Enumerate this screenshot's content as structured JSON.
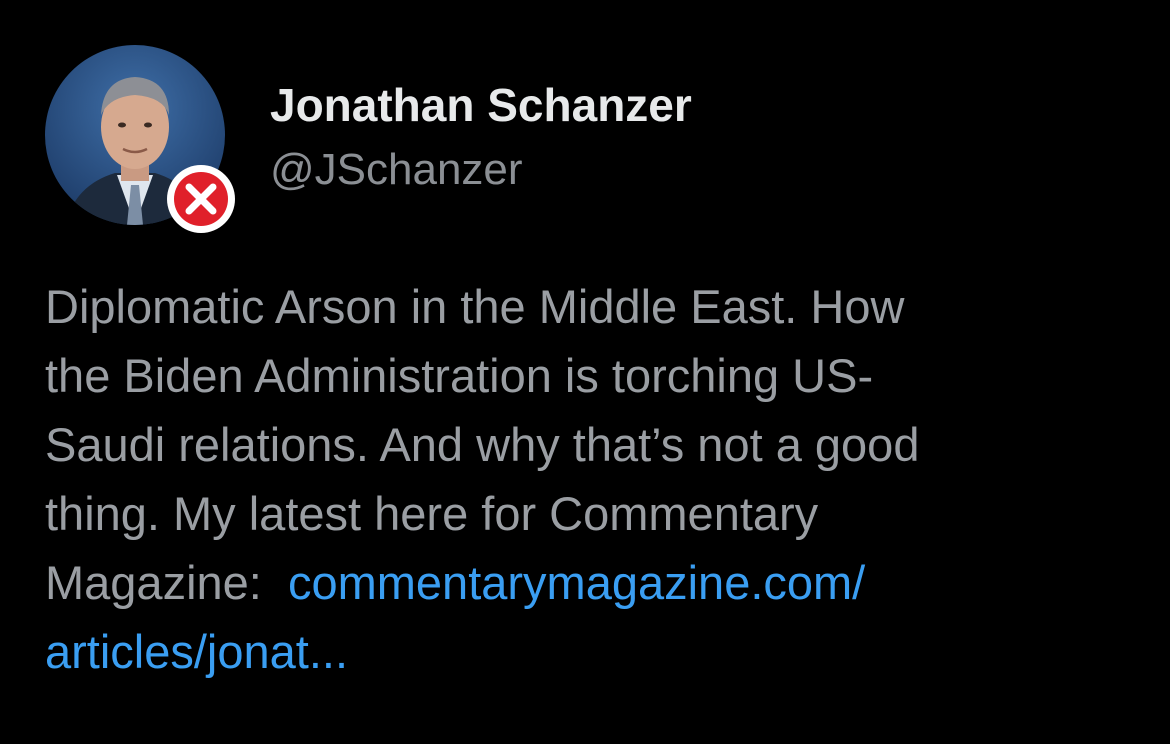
{
  "author": {
    "name": "Jonathan Schanzer",
    "handle": "@JSchanzer"
  },
  "avatar": {
    "icon": "profile-photo",
    "badge_icon": "red-x-circle-icon",
    "badge_color": "#e0202a"
  },
  "tweet": {
    "text_line1": "Diplomatic Arson in the Middle East. How",
    "text_line2": "the Biden Administration is torching US-",
    "text_line3": "Saudi relations. And why that’s not a good",
    "text_line4": "thing. My latest here for Commentary",
    "text_line5_prefix": "Magazine:  ",
    "link_part1": "commentarymagazine.com/",
    "link_part2": "articles/jonat..."
  },
  "colors": {
    "background": "#000000",
    "name": "#e7e9ea",
    "handle": "#8b8f94",
    "body": "#9a9ea3",
    "link": "#3a9ef2"
  }
}
